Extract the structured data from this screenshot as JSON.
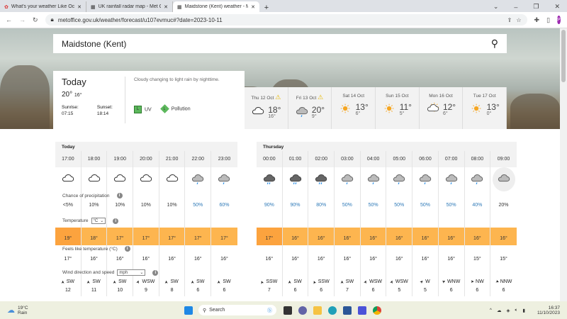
{
  "browser": {
    "tabs": [
      {
        "title": "What's your weather Like Octob",
        "active": false
      },
      {
        "title": "UK rainfall radar map - Met Offic",
        "active": false
      },
      {
        "title": "Maidstone (Kent) weather - Met",
        "active": true
      }
    ],
    "url": "metoffice.gov.uk/weather/forecast/u107evmuc#?date=2023-10-11",
    "profile_initial": "P"
  },
  "search": {
    "value": "Maidstone (Kent)"
  },
  "today": {
    "title": "Today",
    "high": "20°",
    "low": "16°",
    "sunrise_label": "Sunrise:",
    "sunrise": "07:15",
    "sunset_label": "Sunset:",
    "sunset": "18:14",
    "summary": "Cloudy changing to light rain by nighttime.",
    "uv_label": "UV",
    "uv_level": "L",
    "pollution_label": "Pollution",
    "pollution_level": "L"
  },
  "days": [
    {
      "date": "Thu 12 Oct",
      "warning": true,
      "icon": "cloudy",
      "high": "18°",
      "low": "16°"
    },
    {
      "date": "Fri 13 Oct",
      "warning": true,
      "icon": "light-rain",
      "high": "20°",
      "low": "9°"
    },
    {
      "date": "Sat 14 Oct",
      "warning": false,
      "icon": "sunny",
      "high": "13°",
      "low": "6°"
    },
    {
      "date": "Sun 15 Oct",
      "warning": false,
      "icon": "sunny",
      "high": "11°",
      "low": "5°"
    },
    {
      "date": "Mon 16 Oct",
      "warning": false,
      "icon": "sunny-intervals",
      "high": "12°",
      "low": "6°"
    },
    {
      "date": "Tue 17 Oct",
      "warning": false,
      "icon": "sunny",
      "high": "13°",
      "low": "0°"
    }
  ],
  "labels": {
    "precip": "Chance of precipitation",
    "temperature": "Temperature",
    "temp_unit": "°C",
    "feels": "Feels like temperature (°C)",
    "wind": "Wind direction and speed",
    "wind_unit": "mph"
  },
  "hourly": [
    {
      "day": "Today",
      "hours": [
        {
          "time": "17:00",
          "icon": "cloudy",
          "precip": "<5%",
          "temp": "19°",
          "feels": "17°",
          "dir": "SW",
          "speed": "12"
        },
        {
          "time": "18:00",
          "icon": "cloudy",
          "precip": "10%",
          "temp": "18°",
          "feels": "16°",
          "dir": "SW",
          "speed": "11"
        },
        {
          "time": "19:00",
          "icon": "cloudy",
          "precip": "10%",
          "temp": "17°",
          "feels": "16°",
          "dir": "SW",
          "speed": "10"
        },
        {
          "time": "20:00",
          "icon": "cloudy",
          "precip": "10%",
          "temp": "17°",
          "feels": "16°",
          "dir": "WSW",
          "speed": "9"
        },
        {
          "time": "21:00",
          "icon": "cloudy",
          "precip": "10%",
          "temp": "17°",
          "feels": "16°",
          "dir": "SW",
          "speed": "8"
        },
        {
          "time": "22:00",
          "icon": "light-rain",
          "precip": "50%",
          "temp": "17°",
          "feels": "16°",
          "dir": "SW",
          "speed": "6"
        },
        {
          "time": "23:00",
          "icon": "light-rain",
          "precip": "60%",
          "temp": "17°",
          "feels": "16°",
          "dir": "SW",
          "speed": "6"
        }
      ]
    },
    {
      "day": "Thursday",
      "hours": [
        {
          "time": "00:00",
          "icon": "heavy-rain",
          "precip": "90%",
          "temp": "17°",
          "feels": "16°",
          "dir": "SSW",
          "speed": "7"
        },
        {
          "time": "01:00",
          "icon": "heavy-rain",
          "precip": "90%",
          "temp": "16°",
          "feels": "16°",
          "dir": "SW",
          "speed": "6"
        },
        {
          "time": "02:00",
          "icon": "heavy-rain",
          "precip": "80%",
          "temp": "16°",
          "feels": "16°",
          "dir": "SSW",
          "speed": "6"
        },
        {
          "time": "03:00",
          "icon": "light-rain",
          "precip": "50%",
          "temp": "16°",
          "feels": "16°",
          "dir": "SW",
          "speed": "7"
        },
        {
          "time": "04:00",
          "icon": "light-rain",
          "precip": "50%",
          "temp": "16°",
          "feels": "16°",
          "dir": "WSW",
          "speed": "6"
        },
        {
          "time": "05:00",
          "icon": "light-rain",
          "precip": "50%",
          "temp": "16°",
          "feels": "16°",
          "dir": "WSW",
          "speed": "5"
        },
        {
          "time": "06:00",
          "icon": "light-rain",
          "precip": "50%",
          "temp": "16°",
          "feels": "16°",
          "dir": "W",
          "speed": "5"
        },
        {
          "time": "07:00",
          "icon": "light-rain",
          "precip": "50%",
          "temp": "16°",
          "feels": "16°",
          "dir": "WNW",
          "speed": "6"
        },
        {
          "time": "08:00",
          "icon": "light-rain",
          "precip": "40%",
          "temp": "16°",
          "feels": "15°",
          "dir": "NW",
          "speed": "6"
        },
        {
          "time": "09:00",
          "icon": "overcast",
          "precip": "20%",
          "temp": "16°",
          "feels": "15°",
          "dir": "NNW",
          "speed": "6"
        }
      ]
    }
  ],
  "colors": {
    "precip_blue": "#2f7ab8",
    "temp_orange": "#fdb54f",
    "temp_orange_dark": "#fca33e",
    "rain_drop": "#1e88e5"
  },
  "taskbar": {
    "weather_temp": "19°C",
    "weather_desc": "Rain",
    "search_placeholder": "Search",
    "time": "16:37",
    "date": "11/10/2023"
  }
}
